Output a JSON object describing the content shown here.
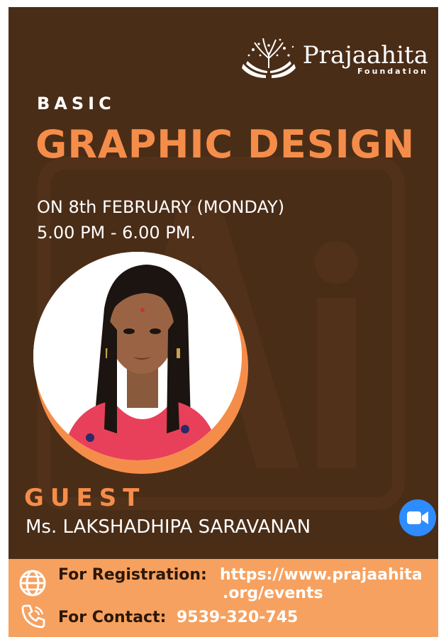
{
  "logo": {
    "name": "Prajaahita",
    "subtitle": "Foundation"
  },
  "event": {
    "kicker": "BASIC",
    "title": "GRAPHIC DESIGN",
    "date": "ON 8th FEBRUARY (MONDAY)",
    "time": "5.00 PM - 6.00 PM."
  },
  "guest": {
    "label": "GUEST",
    "name": "Ms. LAKSHADHIPA SARAVANAN"
  },
  "footer": {
    "registration_label": "For Registration:",
    "registration_url_line1": "https://www.prajaahita",
    "registration_url_line2": ".org/events",
    "contact_label": "For Contact:",
    "contact_value": "9539-320-745"
  },
  "icons": {
    "meeting": "zoom-video-icon",
    "web": "globe-icon",
    "contact": "phone-icon"
  },
  "colors": {
    "background": "#4a2d17",
    "accent": "#f58d4a",
    "footer": "#f6a15f",
    "zoom": "#2d8cff"
  }
}
